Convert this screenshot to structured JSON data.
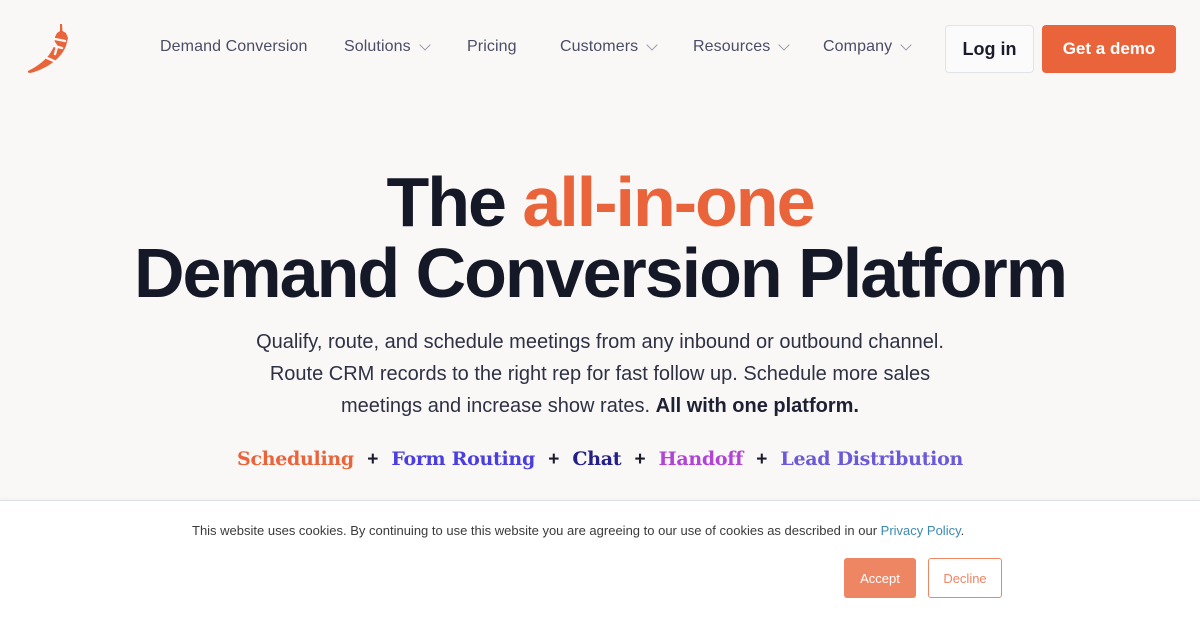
{
  "brand": {
    "logo": "chili-pepper-logo-icon",
    "accent_color": "#e9643a"
  },
  "nav": {
    "items": [
      {
        "label": "Demand Conversion",
        "has_dropdown": false
      },
      {
        "label": "Solutions",
        "has_dropdown": true
      },
      {
        "label": "Pricing",
        "has_dropdown": false
      },
      {
        "label": "Customers",
        "has_dropdown": true
      },
      {
        "label": "Resources",
        "has_dropdown": true
      },
      {
        "label": "Company",
        "has_dropdown": true
      }
    ],
    "login_label": "Log in",
    "demo_label": "Get a demo"
  },
  "hero": {
    "line1_prefix": "The ",
    "line1_accent": "all-in-one",
    "line2": "Demand Conversion Platform",
    "subtitle_line1": "Qualify, route, and schedule meetings from any inbound or outbound channel.",
    "subtitle_line2": "Route CRM records to the right rep for fast follow up. Schedule more sales",
    "subtitle_line3": "meetings and increase show rates. ",
    "subtitle_bold": "All with one platform."
  },
  "products": {
    "separator": "+",
    "items": [
      {
        "label": "Scheduling",
        "color": "#e9643a"
      },
      {
        "label": "Form Routing",
        "color": "#4a3ee0"
      },
      {
        "label": "Chat",
        "color": "#24208a"
      },
      {
        "label": "Handoff",
        "color": "#b144d6"
      },
      {
        "label": "Lead Distribution",
        "color": "#6b5ad8"
      }
    ]
  },
  "cookie_banner": {
    "text": "This website uses cookies. By continuing to use this website you are agreeing to our use of cookies as described in our ",
    "link_label": "Privacy Policy",
    "text_end": ".",
    "accept_label": "Accept",
    "decline_label": "Decline"
  }
}
